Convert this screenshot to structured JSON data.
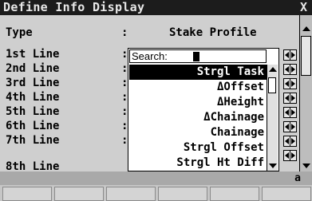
{
  "window": {
    "title": "Define Info Display",
    "close_label": "X"
  },
  "type_row": {
    "label": "Type",
    "colon": ":",
    "value": "Stake Profile"
  },
  "lines": [
    {
      "label": "1st Line",
      "colon": ":"
    },
    {
      "label": "2nd Line",
      "colon": ":"
    },
    {
      "label": "3rd Line",
      "colon": ":"
    },
    {
      "label": "4th Line",
      "colon": ":"
    },
    {
      "label": "5th Line",
      "colon": ":"
    },
    {
      "label": "6th Line",
      "colon": ":"
    },
    {
      "label": "7th Line",
      "colon": ":"
    },
    {
      "label": "8th Line",
      "colon": ""
    }
  ],
  "dropdown": {
    "search_label": "Search:",
    "items": [
      "Strgl Task",
      "ΔOffset",
      "ΔHeight",
      "ΔChainage",
      "Chainage",
      "Strgl Offset",
      "Strgl Ht Diff"
    ],
    "selected": "Strgl Task"
  },
  "status": {
    "input_mode": "a"
  },
  "fkeys": [
    "",
    "",
    "",
    "",
    "",
    ""
  ]
}
